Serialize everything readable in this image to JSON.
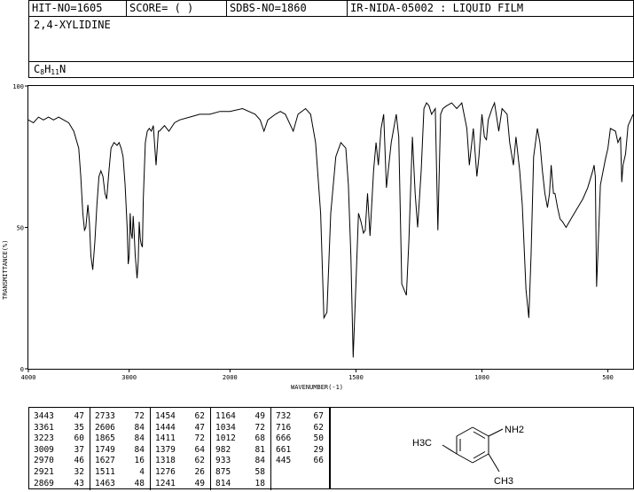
{
  "header": {
    "hit_no": "HIT-NO=1605",
    "score": "SCORE=  (  )",
    "sdbs_no": "SDBS-NO=1860",
    "method": "IR-NIDA-05002 : LIQUID FILM"
  },
  "compound": {
    "name": "2,4-XYLIDINE",
    "formula_parts": [
      "C",
      "8",
      "H",
      "11",
      "N"
    ]
  },
  "chart_data": {
    "type": "line",
    "title": "",
    "xlabel": "WAVENUMBER(-1)",
    "ylabel": "TRANSMITTANCE(%)",
    "xlim": [
      4000,
      400
    ],
    "ylim": [
      0,
      100
    ],
    "xticks": [
      4000,
      3000,
      2000,
      1500,
      1000,
      500
    ],
    "yticks": [
      0,
      50,
      100
    ],
    "series": [
      {
        "x": [
          4000,
          3950,
          3900,
          3850,
          3800,
          3750,
          3700,
          3650,
          3600,
          3550,
          3500,
          3480,
          3460,
          3443,
          3430,
          3410,
          3395,
          3380,
          3361,
          3340,
          3320,
          3300,
          3280,
          3260,
          3240,
          3223,
          3200,
          3180,
          3150,
          3120,
          3100,
          3080,
          3060,
          3040,
          3020,
          3009,
          3000,
          2990,
          2980,
          2970,
          2960,
          2950,
          2940,
          2930,
          2921,
          2910,
          2900,
          2890,
          2880,
          2869,
          2860,
          2840,
          2820,
          2800,
          2780,
          2760,
          2733,
          2710,
          2700,
          2650,
          2606,
          2550,
          2500,
          2400,
          2300,
          2200,
          2100,
          2000,
          1950,
          1900,
          1880,
          1865,
          1850,
          1820,
          1800,
          1780,
          1749,
          1730,
          1700,
          1680,
          1660,
          1640,
          1627,
          1615,
          1600,
          1580,
          1560,
          1540,
          1530,
          1520,
          1511,
          1500,
          1490,
          1480,
          1470,
          1463,
          1454,
          1444,
          1430,
          1420,
          1411,
          1400,
          1390,
          1379,
          1360,
          1340,
          1330,
          1318,
          1300,
          1290,
          1276,
          1265,
          1255,
          1241,
          1230,
          1220,
          1210,
          1200,
          1185,
          1175,
          1164,
          1155,
          1140,
          1120,
          1100,
          1080,
          1060,
          1050,
          1034,
          1020,
          1012,
          1000,
          990,
          982,
          975,
          960,
          950,
          933,
          920,
          900,
          890,
          875,
          865,
          850,
          840,
          825,
          814,
          805,
          795,
          780,
          770,
          760,
          750,
          740,
          732,
          725,
          716,
          710,
          700,
          690,
          680,
          666,
          640,
          600,
          580,
          560,
          555,
          550,
          545,
          540,
          530,
          510,
          500,
          490,
          470,
          460,
          450,
          445,
          440,
          430,
          420,
          410,
          400
        ],
        "y": [
          88,
          87,
          89,
          88,
          89,
          88,
          89,
          88,
          87,
          84,
          78,
          68,
          55,
          49,
          50,
          58,
          52,
          40,
          35,
          45,
          58,
          68,
          70,
          68,
          62,
          60,
          70,
          78,
          80,
          79,
          80,
          78,
          75,
          65,
          50,
          37,
          40,
          55,
          48,
          46,
          54,
          48,
          40,
          36,
          32,
          38,
          52,
          46,
          44,
          43,
          60,
          80,
          84,
          85,
          84,
          86,
          72,
          84,
          84,
          86,
          84,
          87,
          88,
          89,
          90,
          90,
          91,
          91,
          92,
          90,
          88,
          84,
          88,
          90,
          91,
          90,
          84,
          90,
          92,
          90,
          80,
          55,
          18,
          20,
          55,
          75,
          80,
          78,
          65,
          40,
          4,
          30,
          55,
          52,
          48,
          49,
          62,
          47,
          70,
          80,
          72,
          85,
          90,
          64,
          80,
          90,
          82,
          30,
          26,
          45,
          82,
          62,
          50,
          70,
          92,
          94,
          93,
          90,
          92,
          49,
          90,
          92,
          93,
          94,
          92,
          94,
          85,
          72,
          85,
          68,
          75,
          90,
          82,
          81,
          88,
          92,
          94,
          84,
          92,
          90,
          80,
          72,
          82,
          70,
          58,
          28,
          18,
          40,
          75,
          85,
          80,
          70,
          62,
          57,
          62,
          72,
          62,
          62,
          57,
          53,
          52,
          50,
          54,
          60,
          64,
          70,
          72,
          68,
          29,
          40,
          65,
          74,
          78,
          85,
          84,
          80,
          82,
          66,
          72,
          76,
          86,
          88,
          90
        ]
      }
    ]
  },
  "peaks": [
    [
      [
        3443,
        47
      ],
      [
        3361,
        35
      ],
      [
        3223,
        60
      ],
      [
        3009,
        37
      ],
      [
        2970,
        46
      ],
      [
        2921,
        32
      ],
      [
        2869,
        43
      ]
    ],
    [
      [
        2733,
        72
      ],
      [
        2606,
        84
      ],
      [
        1865,
        84
      ],
      [
        1749,
        84
      ],
      [
        1627,
        16
      ],
      [
        1511,
        4
      ],
      [
        1463,
        48
      ]
    ],
    [
      [
        1454,
        62
      ],
      [
        1444,
        47
      ],
      [
        1411,
        72
      ],
      [
        1379,
        64
      ],
      [
        1318,
        62
      ],
      [
        1276,
        26
      ],
      [
        1241,
        49
      ]
    ],
    [
      [
        1164,
        49
      ],
      [
        1034,
        72
      ],
      [
        1012,
        68
      ],
      [
        982,
        81
      ],
      [
        933,
        84
      ],
      [
        875,
        58
      ],
      [
        814,
        18
      ]
    ],
    [
      [
        732,
        67
      ],
      [
        716,
        62
      ],
      [
        666,
        50
      ],
      [
        661,
        29
      ],
      [
        445,
        66
      ]
    ]
  ],
  "structure": {
    "left_group": "H3C",
    "amine": "NH2",
    "methyl": "CH3"
  }
}
